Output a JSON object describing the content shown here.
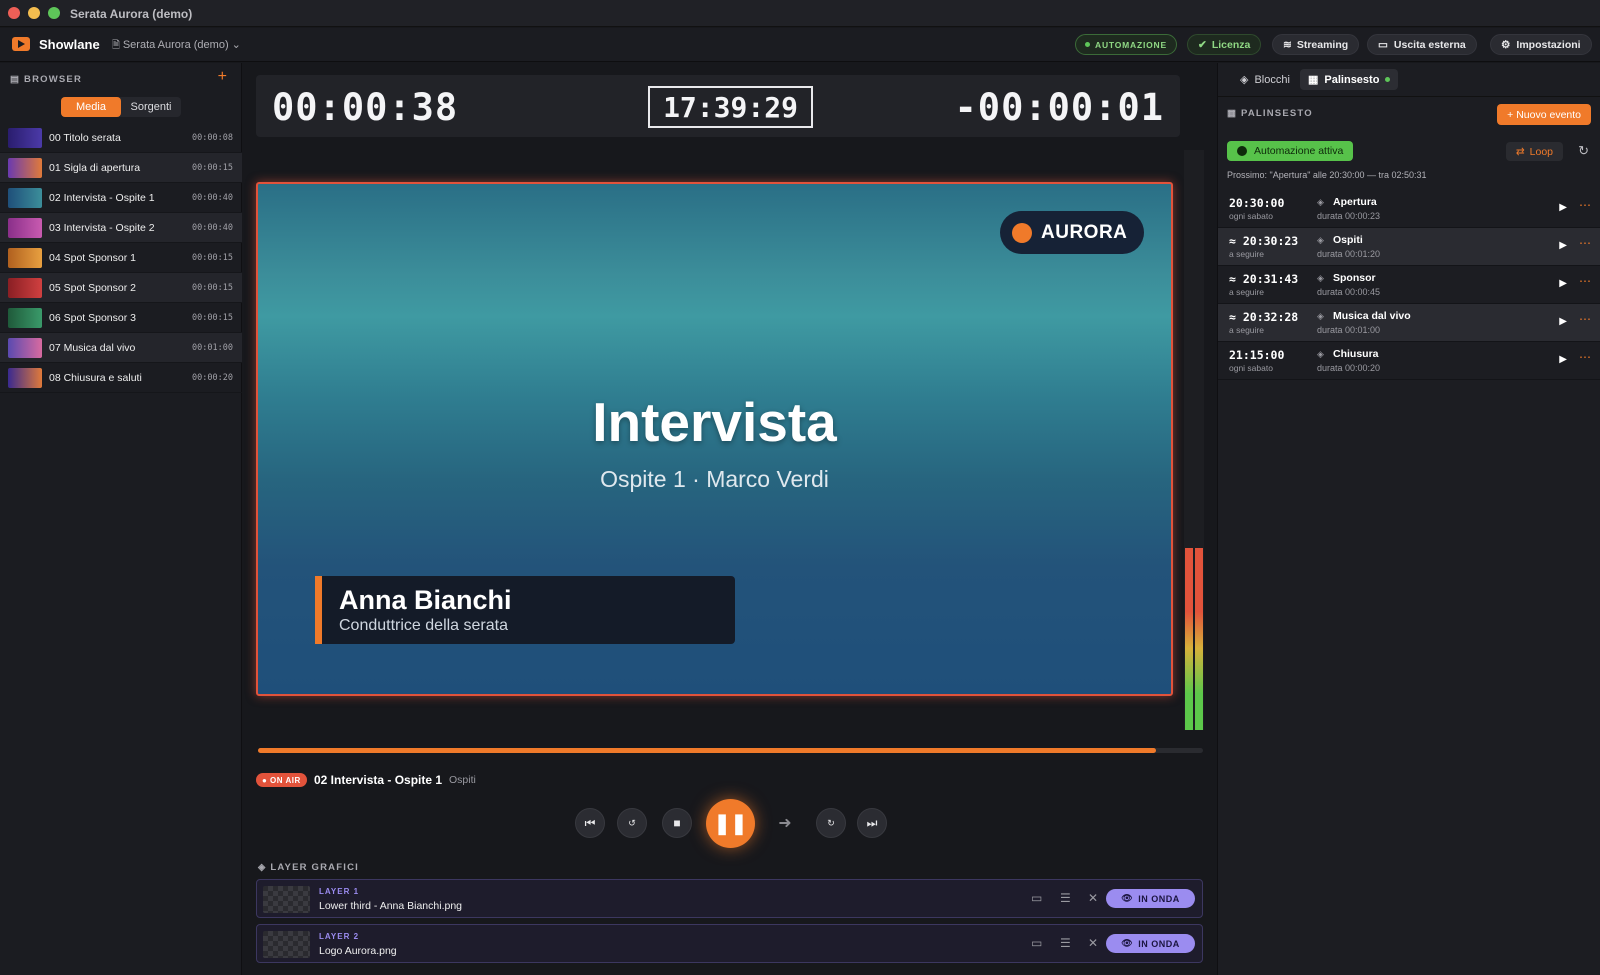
{
  "window": {
    "title": "Serata Aurora (demo)"
  },
  "appbar": {
    "app_name": "Showlane",
    "document": "Serata Aurora (demo) ⌄",
    "buttons": {
      "automation": "AUTOMAZIONE",
      "license": "Licenza",
      "streaming": "Streaming",
      "external_output": "Uscita esterna",
      "settings": "Impostazioni"
    }
  },
  "browser": {
    "title": "BROWSER",
    "add": "+",
    "tabs": [
      "Media",
      "Sorgenti"
    ],
    "items": [
      {
        "name": "00 Titolo serata",
        "duration": "00:00:08"
      },
      {
        "name": "01 Sigla di apertura",
        "duration": "00:00:15"
      },
      {
        "name": "02 Intervista - Ospite 1",
        "duration": "00:00:40"
      },
      {
        "name": "03 Intervista - Ospite 2",
        "duration": "00:00:40"
      },
      {
        "name": "04 Spot Sponsor 1",
        "duration": "00:00:15"
      },
      {
        "name": "05 Spot Sponsor 2",
        "duration": "00:00:15"
      },
      {
        "name": "06 Spot Sponsor 3",
        "duration": "00:00:15"
      },
      {
        "name": "07 Musica dal vivo",
        "duration": "00:01:00"
      },
      {
        "name": "08 Chiusura e saluti",
        "duration": "00:00:20"
      }
    ]
  },
  "timers": {
    "elapsed": "00:00:38",
    "clock": "17:39:29",
    "remaining": "-00:00:01"
  },
  "preview": {
    "badge": "AURORA",
    "title": "Intervista",
    "subtitle": "Ospite 1 · Marco Verdi",
    "lower_third_name": "Anna Bianchi",
    "lower_third_role": "Conduttrice della serata"
  },
  "playback": {
    "progress": 0.95,
    "on_air": "● ON AIR",
    "now_playing": "02 Intervista - Ospite 1",
    "category": "Ospiti"
  },
  "layers": {
    "title": "LAYER GRAFICI",
    "items": [
      {
        "tag": "LAYER 1",
        "name": "Lower third - Anna Bianchi.png",
        "status": "IN ONDA"
      },
      {
        "tag": "LAYER 2",
        "name": "Logo Aurora.png",
        "status": "IN ONDA"
      }
    ]
  },
  "schedule": {
    "tabs": [
      "Blocchi",
      "Palinsesto"
    ],
    "title": "PALINSESTO",
    "new_event": "+ Nuovo evento",
    "automation_active": "Automazione attiva",
    "loop": "Loop",
    "next_info": "Prossimo: \"Apertura\" alle 20:30:00 — tra 02:50:31",
    "events": [
      {
        "time": "20:30:00",
        "rule": "ogni sabato",
        "name": "Apertura",
        "duration": "durata 00:00:23"
      },
      {
        "time": "≈ 20:30:23",
        "rule": "a seguire",
        "name": "Ospiti",
        "duration": "durata 00:01:20"
      },
      {
        "time": "≈ 20:31:43",
        "rule": "a seguire",
        "name": "Sponsor",
        "duration": "durata 00:00:45"
      },
      {
        "time": "≈ 20:32:28",
        "rule": "a seguire",
        "name": "Musica dal vivo",
        "duration": "durata 00:01:00"
      },
      {
        "time": "21:15:00",
        "rule": "ogni sabato",
        "name": "Chiusura",
        "duration": "durata 00:00:20"
      }
    ]
  }
}
